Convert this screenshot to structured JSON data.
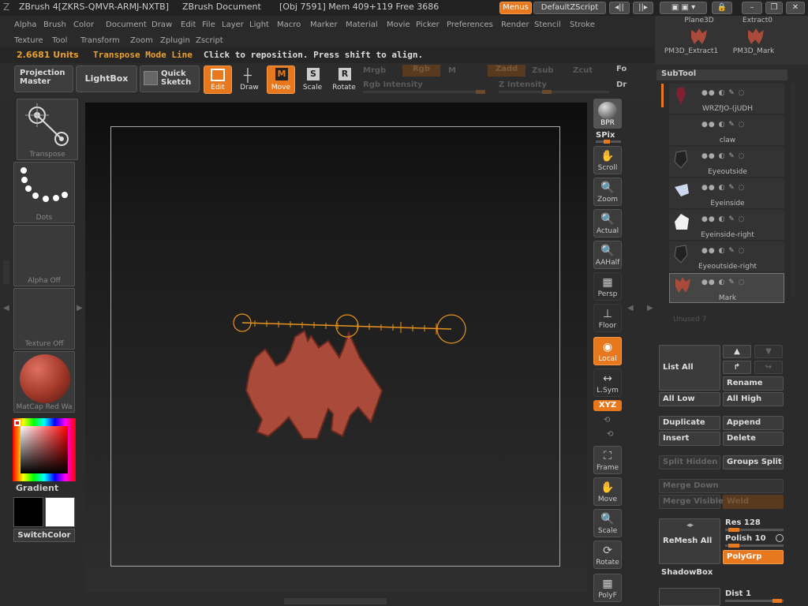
{
  "titlebar": {
    "app_title": "ZBrush 4[ZKRS-QMVR-ARMJ-NXTB]",
    "doc_title": "ZBrush Document",
    "stats": "[Obj 7591] Mem 409+119 Free 3686",
    "menus_button": "Menus",
    "script_button": "DefaultZScript"
  },
  "menu_row1": [
    "Alpha",
    "Brush",
    "Color",
    "Document",
    "Draw",
    "Edit",
    "File",
    "Layer",
    "Light",
    "Macro",
    "Marker",
    "Material",
    "Movie",
    "Picker",
    "Preferences",
    "Render",
    "Stencil",
    "Stroke"
  ],
  "menu_row2": [
    "Texture",
    "Tool",
    "Transform",
    "Zoom",
    "Zplugin",
    "Zscript"
  ],
  "status": {
    "units": "2.6681 Units",
    "mode": "Transpose Mode Line",
    "hint": "Click to reposition. Press shift to align."
  },
  "toolbar": {
    "projection_master": "Projection Master",
    "lightbox": "LightBox",
    "quick_sketch": "Quick Sketch",
    "edit": "Edit",
    "draw": "Draw",
    "move": "Move",
    "scale": "Scale",
    "rotate": "Rotate",
    "mrgb": "Mrgb",
    "rgb": "Rgb",
    "m": "M",
    "zadd": "Zadd",
    "zsub": "Zsub",
    "zcut": "Zcut",
    "rgb_intensity": "Rgb Intensity",
    "z_intensity": "Z Intensity",
    "fo_cut": "Fo",
    "dr_cut": "Dr"
  },
  "left_shelf": {
    "transpose": "Transpose",
    "dots": "Dots",
    "alpha": "Alpha Off",
    "texture": "Texture Off",
    "matcap": "MatCap Red Wa",
    "gradient": "Gradient",
    "switchcolor": "SwitchColor",
    "main_color": "#000000",
    "secondary_color": "#ffffff"
  },
  "right_shelf": {
    "bpr": "BPR",
    "spix": "SPix",
    "scroll": "Scroll",
    "zoom": "Zoom",
    "actual": "Actual",
    "aahalf": "AAHalf",
    "persp": "Persp",
    "floor": "Floor",
    "local": "Local",
    "lsym": "L.Sym",
    "xyz": "XYZ",
    "frame": "Frame",
    "move": "Move",
    "scale": "Scale",
    "rotate": "Rotate",
    "polyf": "PolyF"
  },
  "tool_thumbs": [
    "Plane3D",
    "Extract0",
    "PM3D_Extract1",
    "PM3D_Mark"
  ],
  "subtool": {
    "header": "SubTool",
    "items": [
      {
        "name": "WRZfJO-(jUDH"
      },
      {
        "name": "claw"
      },
      {
        "name": "Eyeoutside"
      },
      {
        "name": "Eyeinside"
      },
      {
        "name": "Eyeinside-right"
      },
      {
        "name": "Eyeoutside-right"
      },
      {
        "name": "Mark"
      }
    ],
    "unused": "Unused 7",
    "list_all": "List All",
    "rename": "Rename",
    "all_low": "All Low",
    "all_high": "All High",
    "duplicate": "Duplicate",
    "append": "Append",
    "insert": "Insert",
    "delete": "Delete",
    "split_hidden": "Split Hidden",
    "groups_split": "Groups Split",
    "merge_down": "Merge Down",
    "merge_visible": "Merge Visible",
    "weld": "Weld",
    "remesh_all": "ReMesh All",
    "res": "Res 128",
    "polish": "Polish 10",
    "polygrp": "PolyGrp",
    "shadowbox": "ShadowBox",
    "dist": "Dist 1"
  },
  "colors": {
    "accent": "#e8781e",
    "mesh": "#a94a3a",
    "bg": "#2b2b2b"
  }
}
